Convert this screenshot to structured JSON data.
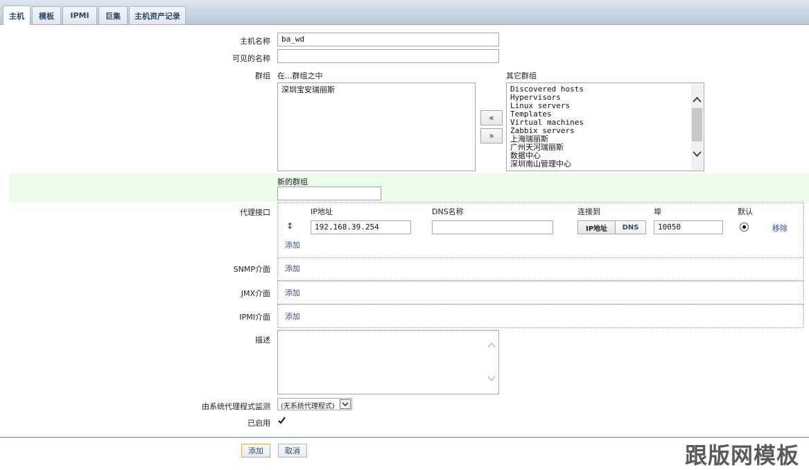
{
  "tabs": [
    "主机",
    "模板",
    "IPMI",
    "巨集",
    "主机资产记录"
  ],
  "form": {
    "hostname_label": "主机名称",
    "hostname_value": "ba_wd",
    "visible_name_label": "可见的名称",
    "visible_name_value": "",
    "groups_label": "群组",
    "in_groups_label": "在...群组之中",
    "in_groups": [
      "深圳宝安瑞丽斯"
    ],
    "other_groups_label": "其它群组",
    "other_groups": [
      "Discovered hosts",
      "Hypervisors",
      "Linux servers",
      "Templates",
      "Virtual machines",
      "Zabbix servers",
      "上海瑞丽斯",
      "广州天河瑞丽斯",
      "数据中心",
      "深圳南山管理中心"
    ],
    "move_left": "«",
    "move_right": "»",
    "new_group_label": "新的群组",
    "new_group_value": "",
    "agent_iface_label": "代理接口",
    "snmp_label": "SNMP介面",
    "jmx_label": "JMX介面",
    "ipmi_label": "IPMI介面",
    "description_label": "描述",
    "description_value": "",
    "proxy_label": "由系统代理程式监测",
    "proxy_value": "(无系统代理程式)",
    "enabled_label": "已启用",
    "enabled": true
  },
  "interface": {
    "col_ip": "IP地址",
    "col_dns": "DNS名称",
    "col_connect": "连接到",
    "col_port": "埠",
    "col_default": "默认",
    "ip_value": "192.168.39.254",
    "dns_value": "",
    "connect_ip": "IP地址",
    "connect_dns": "DNS",
    "port_value": "10050",
    "remove": "移除",
    "add": "添加"
  },
  "buttons": {
    "add": "添加",
    "cancel": "取消"
  },
  "watermark": "跟版网模板",
  "colors": {
    "accent": "#2b4a6b",
    "new_group_band": "#ebfbe9"
  }
}
